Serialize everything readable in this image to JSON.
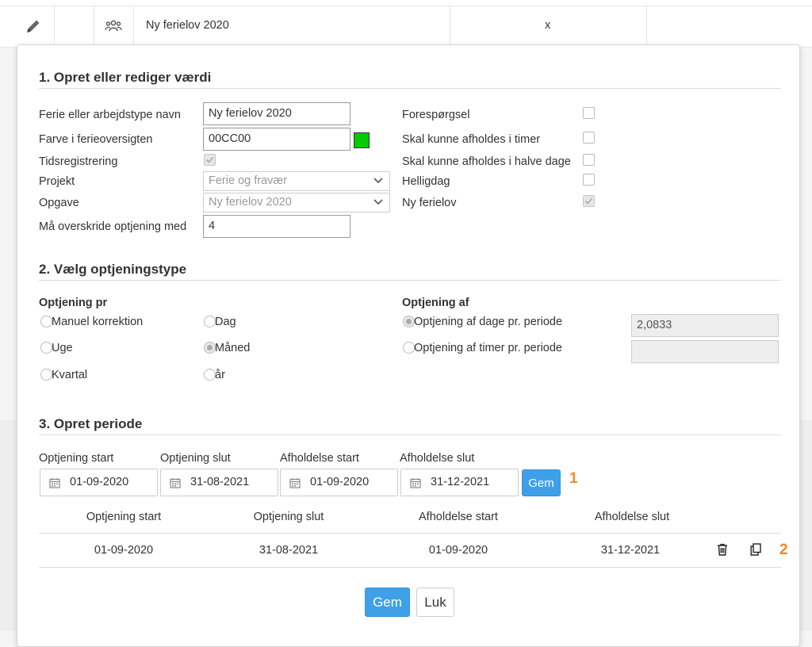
{
  "background_row": {
    "name": "Ny ferielov 2020",
    "mark": "x"
  },
  "section1": {
    "title": "1. Opret eller rediger værdi",
    "name_label": "Ferie eller arbejdstype navn",
    "name_value": "Ny ferielov 2020",
    "color_label": "Farve i ferieoversigten",
    "color_value": "00CC00",
    "color_swatch": "#00CC00",
    "timereg_label": "Tidsregistrering",
    "project_label": "Projekt",
    "project_value": "Ferie og fravær",
    "task_label": "Opgave",
    "task_value": "Ny ferielov 2020",
    "exceed_label": "Må overskride optjening med",
    "exceed_value": "4",
    "request_label": "Forespørgsel",
    "hours_label": "Skal kunne afholdes i timer",
    "halfdays_label": "Skal kunne afholdes i halve dage",
    "holiday_label": "Helligdag",
    "newlaw_label": "Ny ferielov"
  },
  "section2": {
    "title": "2. Vælg optjeningstype",
    "per_heading": "Optjening pr",
    "opt_manual": "Manuel korrektion",
    "opt_day": "Dag",
    "opt_week": "Uge",
    "opt_month": "Måned",
    "opt_quarter": "Kvartal",
    "opt_year": "år",
    "of_heading": "Optjening af",
    "opt_days_per_period": "Optjening af dage pr. periode",
    "days_value": "2,0833",
    "opt_hours_per_period": "Optjening af timer pr. periode",
    "hours_value": ""
  },
  "section3": {
    "title": "3. Opret periode",
    "earn_start_label": "Optjening start",
    "earn_end_label": "Optjening slut",
    "hold_start_label": "Afholdelse start",
    "hold_end_label": "Afholdelse slut",
    "earn_start": "01-09-2020",
    "earn_end": "31-08-2021",
    "hold_start": "01-09-2020",
    "hold_end": "31-12-2021",
    "save_label": "Gem",
    "marker1": "1",
    "marker2": "2",
    "table_headers": [
      "Optjening start",
      "Optjening slut",
      "Afholdelse start",
      "Afholdelse slut"
    ],
    "rows": [
      [
        "01-09-2020",
        "31-08-2021",
        "01-09-2020",
        "31-12-2021"
      ]
    ]
  },
  "footer": {
    "save_label": "Gem",
    "close_label": "Luk"
  }
}
